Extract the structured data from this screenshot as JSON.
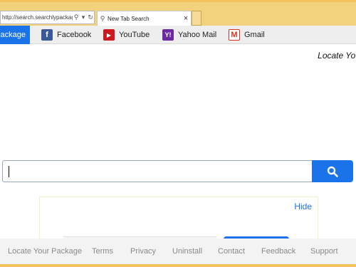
{
  "browser": {
    "address_url": "http://search.searchlypackag...",
    "tab_title": "New Tab Search",
    "close_glyph": "×"
  },
  "bookmarks": {
    "primary_label": "Package",
    "items": [
      {
        "label": "Facebook",
        "icon": "facebook-icon",
        "glyph": "f",
        "color": "#3b5998"
      },
      {
        "label": "YouTube",
        "icon": "youtube-icon",
        "glyph": "▶",
        "color": "#cc181e"
      },
      {
        "label": "Yahoo Mail",
        "icon": "yahoo-icon",
        "glyph": "Y!",
        "color": "#6b2aa1"
      },
      {
        "label": "Gmail",
        "icon": "gmail-icon",
        "glyph": "M",
        "color": "#d93025"
      }
    ]
  },
  "header": {
    "tagline": "Locate You"
  },
  "search": {
    "placeholder": "",
    "button_icon": "search-icon"
  },
  "panel": {
    "hide_label": "Hide"
  },
  "footer": {
    "links": [
      "Locate Your Package",
      "Terms",
      "Privacy",
      "Uninstall",
      "Contact",
      "Feedback",
      "Support"
    ]
  },
  "colors": {
    "accent": "#1a73e8",
    "chrome": "#f1c35a"
  }
}
